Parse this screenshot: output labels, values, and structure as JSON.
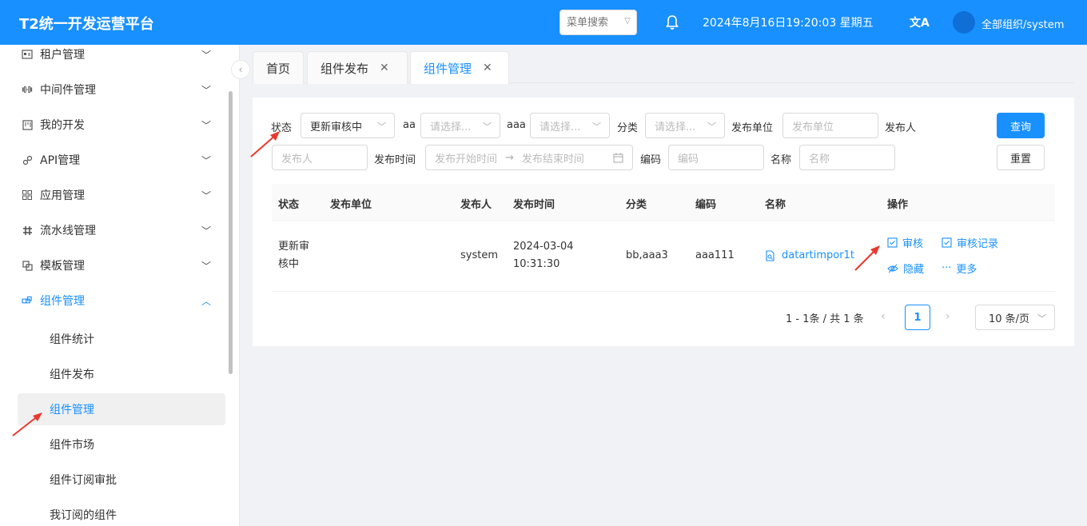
{
  "header": {
    "brand": "T2统一开发运营平台",
    "menu_search_placeholder": "菜单搜索",
    "datetime": "2024年8月16日19:20:03 星期五",
    "translate_glyph": "文A",
    "org_user": "全部组织/system"
  },
  "sidebar": {
    "items": [
      {
        "label": "租户管理",
        "icon": "id-card-icon"
      },
      {
        "label": "中间件管理",
        "icon": "dumbbell-icon"
      },
      {
        "label": "我的开发",
        "icon": "board-icon"
      },
      {
        "label": "API管理",
        "icon": "link-icon"
      },
      {
        "label": "应用管理",
        "icon": "grid-icon"
      },
      {
        "label": "流水线管理",
        "icon": "pipeline-icon"
      },
      {
        "label": "模板管理",
        "icon": "template-icon"
      },
      {
        "label": "组件管理",
        "icon": "component-icon"
      }
    ],
    "sub_items": [
      "组件统计",
      "组件发布",
      "组件管理",
      "组件市场",
      "组件订阅审批",
      "我订阅的组件"
    ],
    "selected_sub": "组件管理"
  },
  "tabs": [
    {
      "label": "首页",
      "closable": false
    },
    {
      "label": "组件发布",
      "closable": true
    },
    {
      "label": "组件管理",
      "closable": true,
      "active": true
    }
  ],
  "filters": {
    "status_label": "状态",
    "status_value": "更新审核中",
    "aa_label": "aa",
    "aa_placeholder": "请选择...",
    "aaa_label": "aaa",
    "aaa_placeholder": "请选择...",
    "category_label": "分类",
    "category_placeholder": "请选择...",
    "publish_unit_label": "发布单位",
    "publish_unit_placeholder": "发布单位",
    "publisher_label": "发布人",
    "publisher_placeholder": "发布人",
    "publish_time_label": "发布时间",
    "start_placeholder": "发布开始时间",
    "end_placeholder": "发布结束时间",
    "code_label": "编码",
    "code_placeholder": "编码",
    "name_label": "名称",
    "name_placeholder": "名称",
    "query_button": "查询",
    "reset_button": "重置"
  },
  "table": {
    "columns": [
      "状态",
      "发布单位",
      "发布人",
      "发布时间",
      "分类",
      "编码",
      "名称",
      "操作"
    ],
    "rows": [
      {
        "status_line1": "更新审",
        "status_line2": "核中",
        "unit": "",
        "publisher": "system",
        "time_line1": "2024-03-04",
        "time_line2": "10:31:30",
        "category": "bb,aaa3",
        "code": "aaa111",
        "name": "datartimpor1t",
        "ops": {
          "review": "审核",
          "review_log": "审核记录",
          "hide": "隐藏",
          "more": "更多"
        }
      }
    ]
  },
  "pagination": {
    "total_text": "1 - 1条 / 共 1 条",
    "current_page": "1",
    "page_size": "10 条/页"
  },
  "colors": {
    "primary": "#1890ff",
    "annotation_arrow": "#e8392f"
  }
}
